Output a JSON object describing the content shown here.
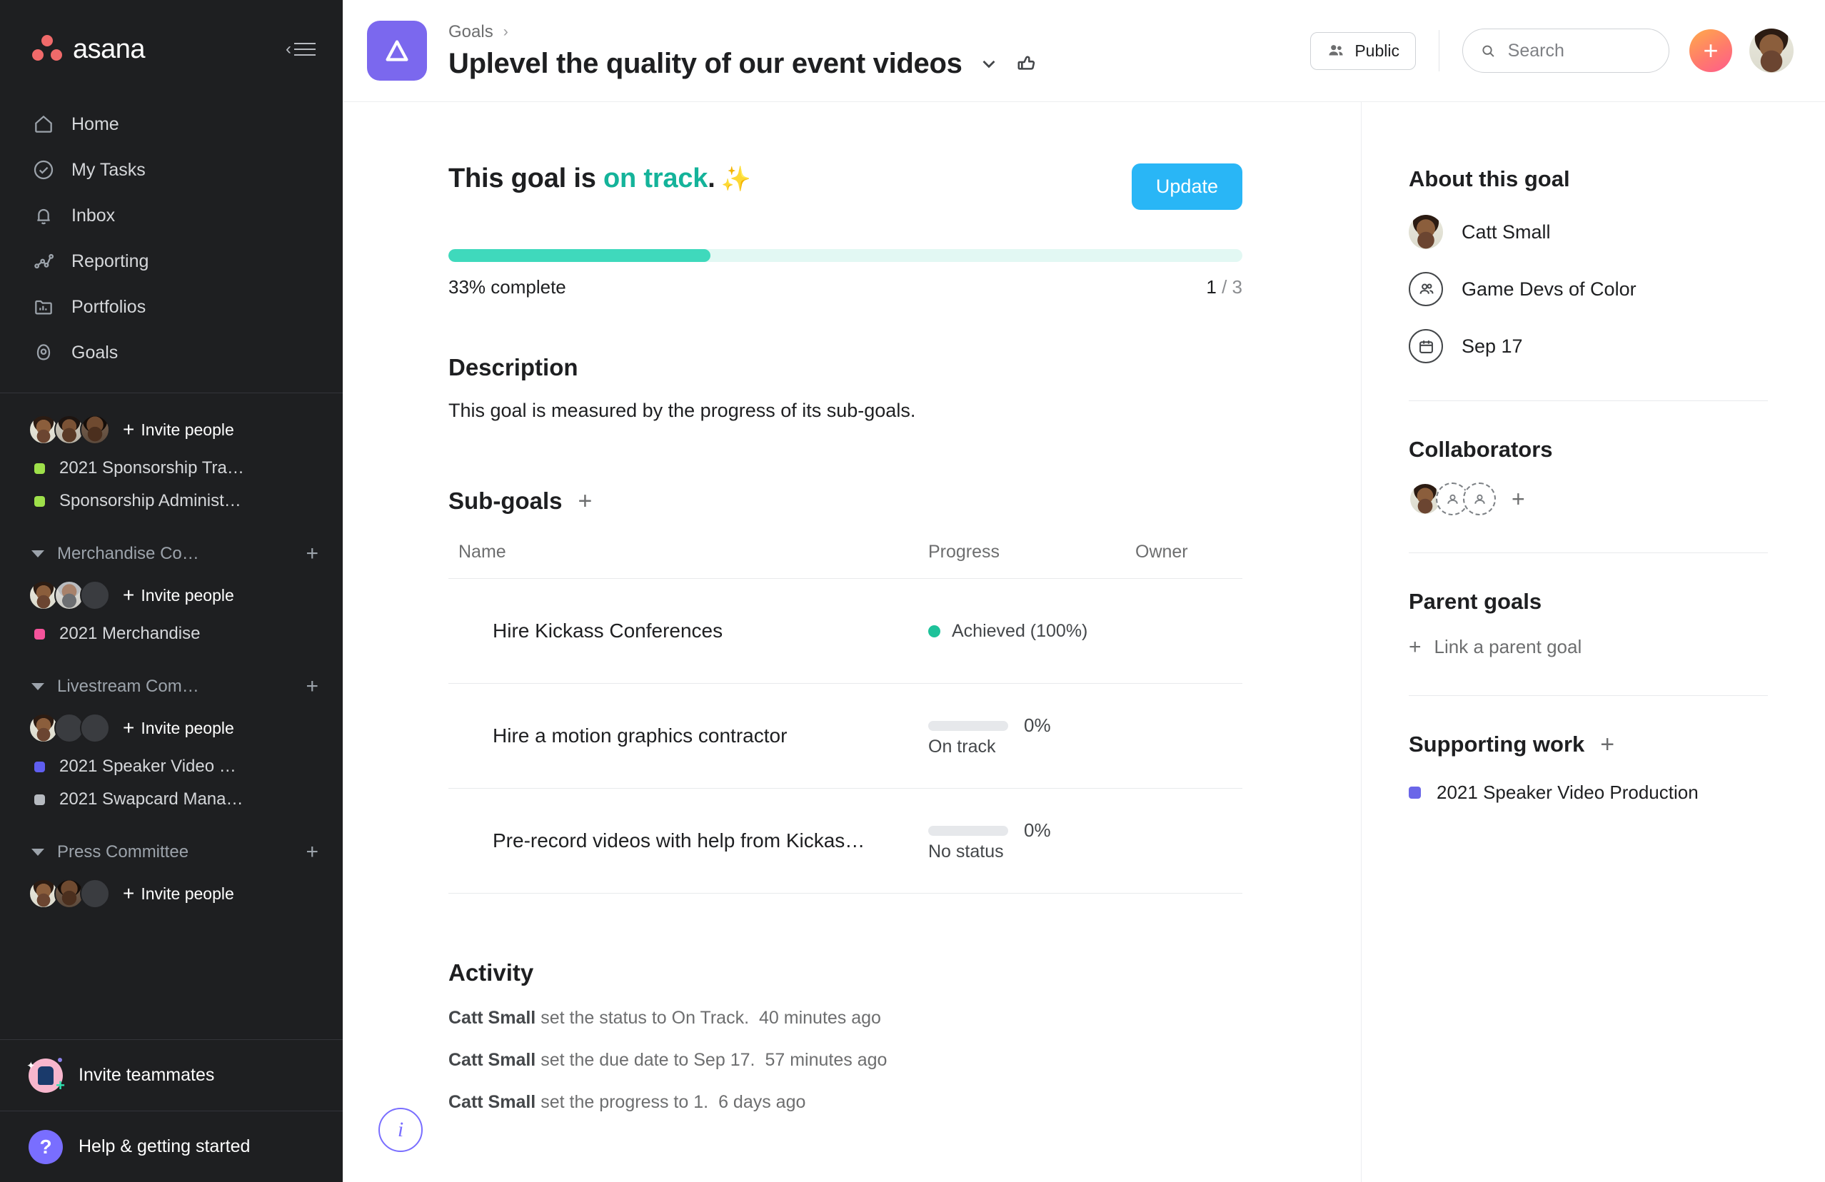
{
  "sidebar": {
    "brand": "asana",
    "collapse_icon": "collapse-sidebar-icon",
    "nav": [
      {
        "label": "Home",
        "icon": "home-icon"
      },
      {
        "label": "My Tasks",
        "icon": "check-circle-icon"
      },
      {
        "label": "Inbox",
        "icon": "bell-icon"
      },
      {
        "label": "Reporting",
        "icon": "line-chart-icon"
      },
      {
        "label": "Portfolios",
        "icon": "folder-chart-icon"
      },
      {
        "label": "Goals",
        "icon": "goal-person-icon"
      }
    ],
    "invite_label": "Invite people",
    "groups": [
      {
        "header": null,
        "avatars": [
          "catt",
          "m1",
          "m2"
        ],
        "projects": [
          {
            "name": "2021 Sponsorship Tra…",
            "color": "#9ee04a"
          },
          {
            "name": "Sponsorship Administ…",
            "color": "#9ee04a"
          }
        ]
      },
      {
        "header": "Merchandise Co…",
        "avatars": [
          "catt",
          "m3",
          "empty"
        ],
        "projects": [
          {
            "name": "2021 Merchandise",
            "color": "#f5539b"
          }
        ]
      },
      {
        "header": "Livestream Com…",
        "avatars": [
          "catt",
          "empty",
          "empty"
        ],
        "projects": [
          {
            "name": "2021 Speaker Video …",
            "color": "#5f5ef0"
          },
          {
            "name": "2021 Swapcard Mana…",
            "color": "#b6bac0"
          }
        ]
      },
      {
        "header": "Press Committee",
        "avatars": [
          "catt",
          "m2",
          "empty"
        ],
        "projects": []
      }
    ],
    "invite_teammates": "Invite teammates",
    "help": "Help & getting started"
  },
  "topbar": {
    "breadcrumb_parent": "Goals",
    "breadcrumb_separator": "›",
    "title": "Uplevel the quality of our event videos",
    "goal_icon": "goal-triangle-icon",
    "title_caret_icon": "chevron-down-icon",
    "thumbs_up_icon": "thumbs-up-icon",
    "privacy_label": "Public",
    "privacy_icon": "people-icon",
    "search_placeholder": "Search",
    "search_value": "",
    "search_icon": "search-icon",
    "create_label": "+",
    "profile_avatar": "catt"
  },
  "goal": {
    "status_prefix": "This goal is ",
    "status_value": "on track",
    "status_suffix": ".",
    "status_emoji": "✨",
    "status_color": "#14b39a",
    "update_button": "Update",
    "progress_percent": 33,
    "progress_label": "33% complete",
    "progress_numerator": "1",
    "progress_separator": " / ",
    "progress_denominator": "3",
    "description_title": "Description",
    "description_text": "This goal is measured by the progress of its sub-goals."
  },
  "subgoals": {
    "title": "Sub-goals",
    "add_icon": "plus-icon",
    "columns": {
      "name": "Name",
      "progress": "Progress",
      "owner": "Owner"
    },
    "rows": [
      {
        "name": "Hire Kickass Conferences",
        "progress_type": "achieved",
        "progress_text": "Achieved (100%)",
        "progress_percent": 100,
        "status": "",
        "owner_avatar": "catt"
      },
      {
        "name": "Hire a motion graphics contractor",
        "progress_type": "bar",
        "progress_text": "0%",
        "progress_percent": 0,
        "status": "On track",
        "owner_avatar": "catt"
      },
      {
        "name": "Pre-record videos with help from Kickas…",
        "progress_type": "bar",
        "progress_text": "0%",
        "progress_percent": 0,
        "status": "No status",
        "owner_avatar": "catt"
      }
    ]
  },
  "activity": {
    "title": "Activity",
    "entries": [
      {
        "actor": "Catt Small",
        "text": " set the status to On Track.",
        "time": "40 minutes ago"
      },
      {
        "actor": "Catt Small",
        "text": " set the due date to Sep 17.",
        "time": "57 minutes ago"
      },
      {
        "actor": "Catt Small",
        "text": " set the progress to 1.",
        "time": "6 days ago"
      }
    ]
  },
  "info_fab": {
    "icon": "info-icon",
    "label": "i"
  },
  "right_panel": {
    "about_title": "About this goal",
    "about_items": [
      {
        "label": "Catt Small",
        "icon": "avatar",
        "avatar": "catt"
      },
      {
        "label": "Game Devs of Color",
        "icon": "team-icon"
      },
      {
        "label": "Sep 17",
        "icon": "calendar-icon"
      }
    ],
    "collaborators_title": "Collaborators",
    "collaborators": [
      "catt",
      "placeholder",
      "placeholder"
    ],
    "collaborators_add_icon": "plus-icon",
    "parent_goals_title": "Parent goals",
    "link_parent_label": "Link a parent goal",
    "supporting_work_title": "Supporting work",
    "supporting_work_add_icon": "plus-icon",
    "supporting_work_items": [
      {
        "name": "2021 Speaker Video Production",
        "color": "#6a66e8"
      }
    ]
  }
}
